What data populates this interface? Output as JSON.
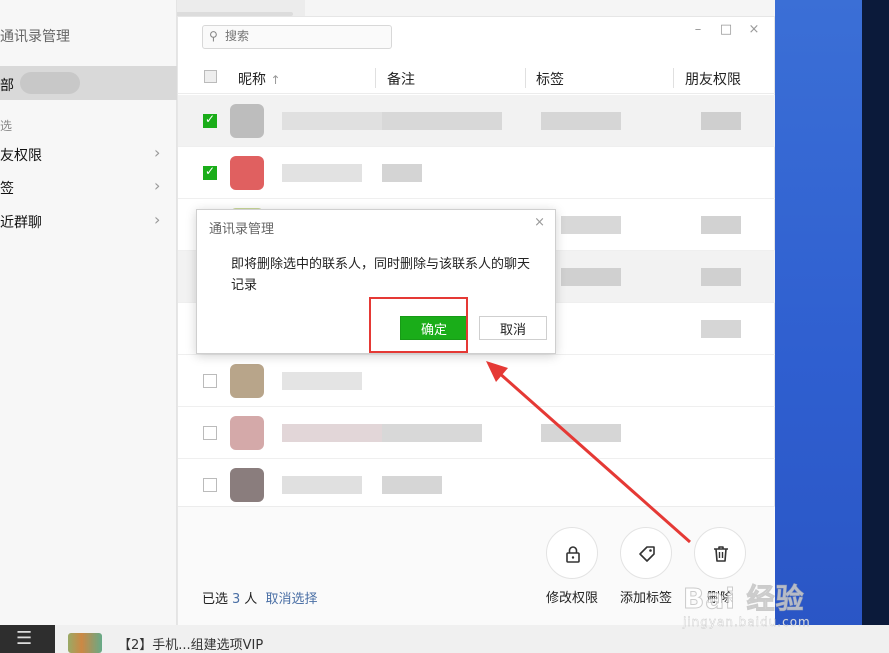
{
  "left_panel": {
    "title": "通讯录管理",
    "all_label": "部",
    "filter_label": "选",
    "items": [
      {
        "label": "友权限"
      },
      {
        "label": "签"
      },
      {
        "label": "近群聊"
      }
    ]
  },
  "search": {
    "placeholder": "搜索"
  },
  "window_controls": {
    "minimize": "–",
    "maximize": "□",
    "close": "×"
  },
  "table": {
    "headers": {
      "nickname": "昵称",
      "sort_indicator": "↑",
      "remark": "备注",
      "tags": "标签",
      "permission": "朋友权限"
    },
    "rows": [
      {
        "checked": true
      },
      {
        "checked": true
      },
      {
        "checked": true
      },
      {
        "checked": false
      },
      {
        "checked": false
      },
      {
        "checked": false
      },
      {
        "checked": false
      },
      {
        "checked": false
      }
    ]
  },
  "footer": {
    "selected_prefix": "已选",
    "selected_count": "3",
    "selected_suffix": "人",
    "cancel_selection": "取消选择",
    "actions": {
      "modify_permission": "修改权限",
      "add_tag": "添加标签",
      "delete": "删除"
    }
  },
  "dialog": {
    "title": "通讯录管理",
    "close": "×",
    "message": "即将删除选中的联系人，同时删除与该联系人的聊天记录",
    "confirm": "确定",
    "cancel": "取消"
  },
  "taskbar": {
    "menu_glyph": "☰",
    "text": "【2】手机...组建选项VIP"
  },
  "watermark": {
    "main": "Bai 经验",
    "sub": "jingyan.baidu.com"
  },
  "colors": {
    "accent_green": "#1aad19",
    "link_blue": "#4a6fa5",
    "annotation_red": "#e53935"
  }
}
